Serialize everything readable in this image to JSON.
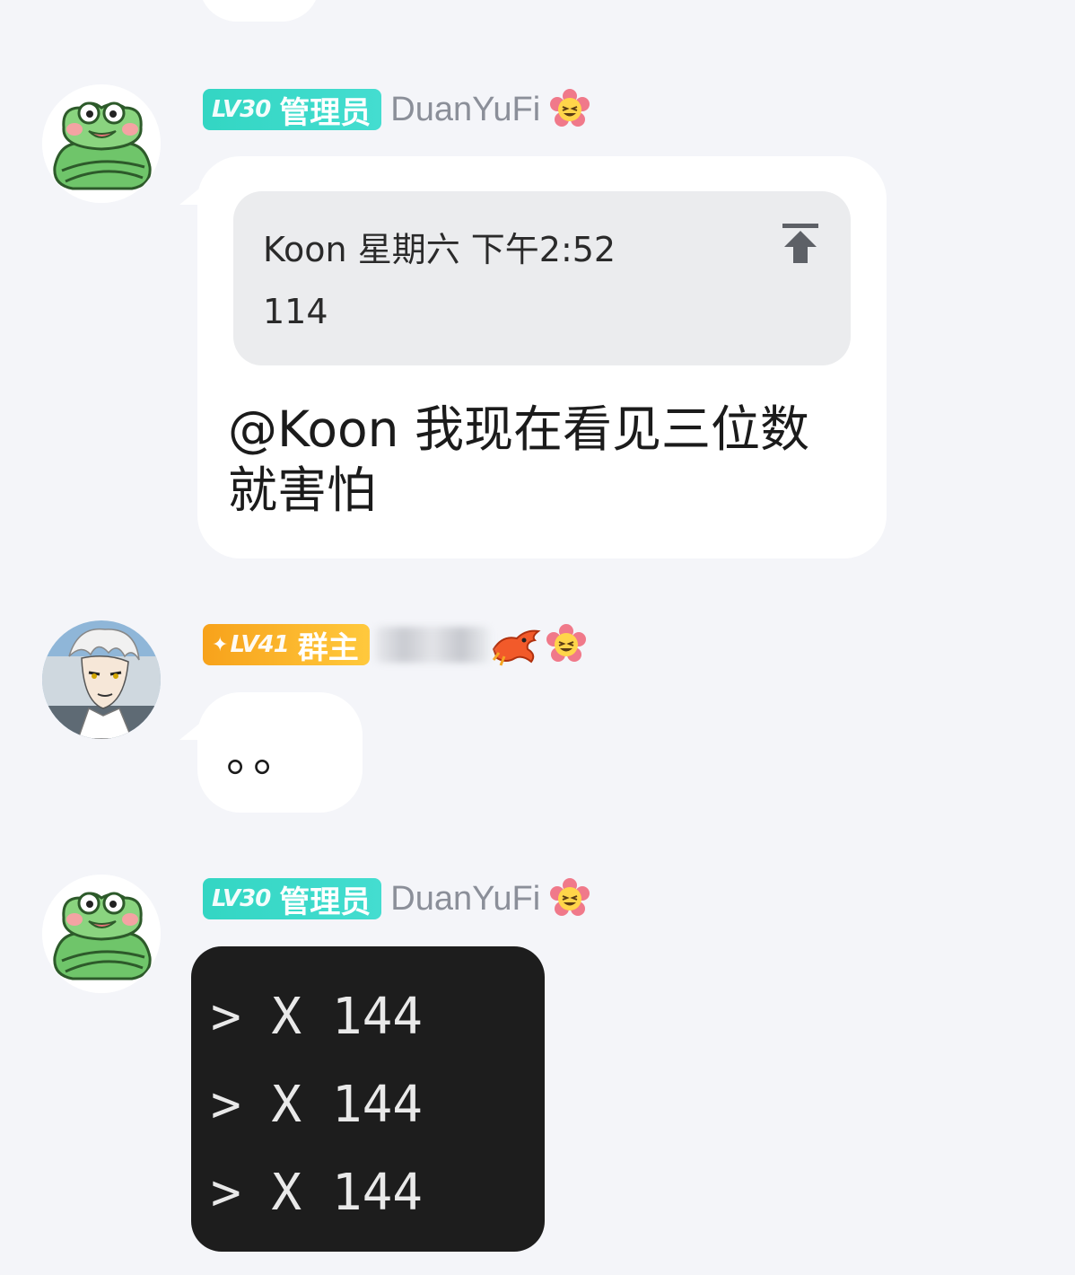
{
  "messages": [
    {
      "badge_level": "LV30",
      "badge_role": "管理员",
      "username": "DuanYuFi",
      "quote": {
        "author_time": "Koon 星期六 下午2:52",
        "text": "114"
      },
      "text_line1": "@Koon 我现在看见三位数",
      "text_line2": "就害怕"
    },
    {
      "badge_level": "LV41",
      "badge_role": "群主",
      "username": "",
      "text": "。。"
    },
    {
      "badge_level": "LV30",
      "badge_role": "管理员",
      "username": "DuanYuFi",
      "image_lines": [
        "> X 144",
        "> X 144",
        "> X 144"
      ]
    }
  ],
  "colors": {
    "background": "#f4f5f9",
    "bubble": "#ffffff",
    "admin_badge": "#33d6c3",
    "owner_badge": "#f7a21b",
    "username": "#8b8f99"
  }
}
